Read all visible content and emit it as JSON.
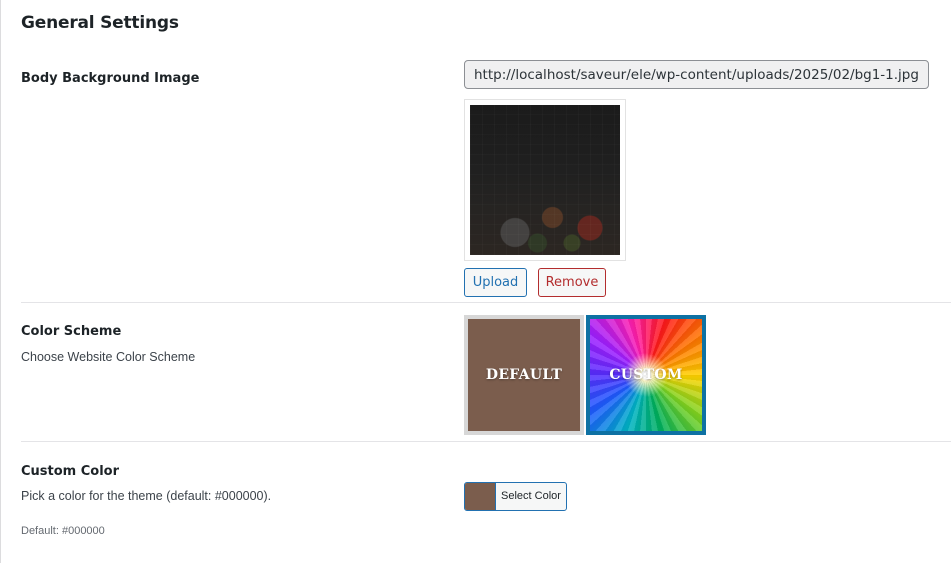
{
  "section": {
    "title": "General Settings"
  },
  "body_background": {
    "label": "Body Background Image",
    "url_value": "http://localhost/saveur/ele/wp-content/uploads/2025/02/bg1-1.jpg",
    "upload_label": "Upload",
    "remove_label": "Remove"
  },
  "color_scheme": {
    "label": "Color Scheme",
    "description": "Choose Website Color Scheme",
    "options": [
      {
        "label": "DEFAULT",
        "color": "#7b5d4d",
        "selected": false
      },
      {
        "label": "CUSTOM",
        "selected": true
      }
    ]
  },
  "custom_color": {
    "label": "Custom Color",
    "description": "Pick a color for the theme (default: #000000).",
    "select_label": "Select Color",
    "current_color": "#7b5d4d",
    "default_note": "Default: #000000"
  },
  "colors": {
    "primary_blue": "#2271b1",
    "danger_red": "#b32d2e",
    "selected_border": "#0e71a3"
  }
}
